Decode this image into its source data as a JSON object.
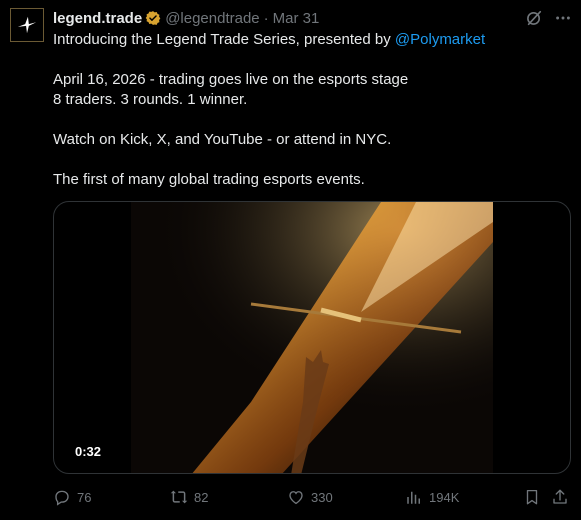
{
  "author": {
    "display_name": "legend.trade",
    "handle": "@legendtrade",
    "separator": "·",
    "date": "Mar 31",
    "verified": true,
    "verified_color": "#d8a330"
  },
  "body": {
    "line1_text": "Introducing the Legend Trade Series, presented by ",
    "line1_mention": "@Polymarket",
    "line2": "April 16, 2026 - trading goes live on the esports stage",
    "line3": "8 traders. 3 rounds. 1 winner.",
    "line4": "Watch on Kick, X, and YouTube - or attend in NYC.",
    "line5": "The first of many global trading esports events."
  },
  "media": {
    "duration": "0:32"
  },
  "actions": {
    "replies": "76",
    "reposts": "82",
    "likes": "330",
    "views": "194K"
  },
  "icons": {
    "avatar": "legend-star-logo",
    "top_right": [
      "grok-icon",
      "more-icon"
    ],
    "actions": [
      "reply-icon",
      "repost-icon",
      "like-icon",
      "views-icon",
      "bookmark-icon",
      "share-icon"
    ]
  },
  "colors": {
    "background": "#000000",
    "text": "#e7e9ea",
    "muted": "#71767b",
    "link": "#1d9bf0"
  }
}
